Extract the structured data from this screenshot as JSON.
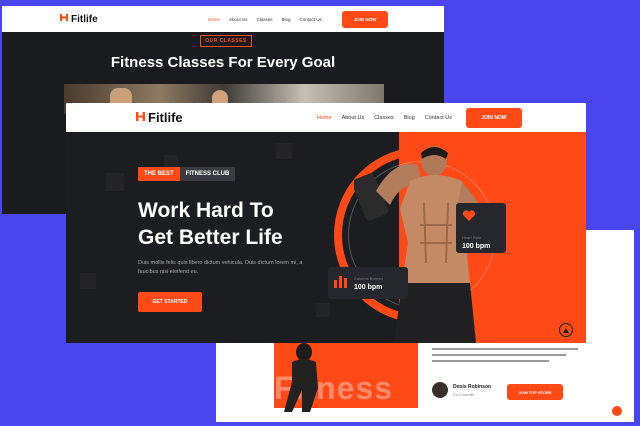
{
  "back_page": {
    "logo": "Fitlife",
    "nav": [
      "Home",
      "About Us",
      "Classes",
      "Blog",
      "Contact Us"
    ],
    "cta": "JOIN NOW",
    "section_tag": "OUR CLASSES",
    "section_title": "Fitness Classes For Every Goal"
  },
  "front_page": {
    "logo": "Fitlife",
    "nav": [
      "Home",
      "About Us",
      "Classes",
      "Blog",
      "Contact Us"
    ],
    "cta": "JOIN NOW",
    "badge_left": "THE BEST",
    "badge_right": "FITNESS CLUB",
    "headline_line1": "Work Hard To",
    "headline_line2": "Get Better Life",
    "description": "Duis mollis felis quis libero dictum vehicula. Duis dictum lorem mi, a faucibus nisi eleifend eu.",
    "button": "GET STARTED",
    "card_heart": {
      "label": "Heart Rate",
      "value": "100 bpm"
    },
    "card_calories": {
      "label": "Calories Burned",
      "value": "100 bpm"
    }
  },
  "right_page": {
    "bg_word": "Fitness",
    "person_name": "Denis Robinson",
    "person_role": "Co Founder",
    "button": "JOIN TOP STORE"
  },
  "colors": {
    "accent": "#ff4a17",
    "dark": "#1c1d21",
    "background": "#4b45f0"
  }
}
